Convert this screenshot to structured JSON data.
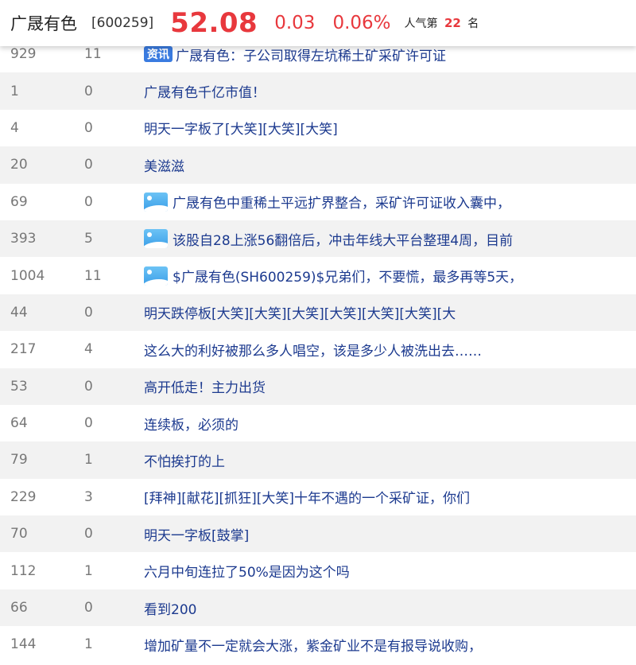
{
  "header": {
    "stock_name": "广晟有色",
    "stock_code": "[600259]",
    "price": "52.08",
    "change": "0.03",
    "change_pct": "0.06%",
    "popularity_prefix": "人气第",
    "popularity_rank": "22",
    "popularity_suffix": "名"
  },
  "colors": {
    "up": "#e8383d",
    "title_link": "#1c3a8f",
    "meta": "#777777"
  },
  "posts": [
    {
      "reads": "929",
      "replies": "11",
      "title": "广晟有色：子公司取得左坑稀土矿采矿许可证",
      "tag": "资讯",
      "has_image": false
    },
    {
      "reads": "1",
      "replies": "0",
      "title": "广晟有色千亿市值！",
      "tag": "",
      "has_image": false
    },
    {
      "reads": "4",
      "replies": "0",
      "title": "明天一字板了[大笑][大笑][大笑]",
      "tag": "",
      "has_image": false
    },
    {
      "reads": "20",
      "replies": "0",
      "title": "美滋滋",
      "tag": "",
      "has_image": false
    },
    {
      "reads": "69",
      "replies": "0",
      "title": "广晟有色中重稀土平远扩界整合，采矿许可证收入囊中，",
      "tag": "",
      "has_image": true
    },
    {
      "reads": "393",
      "replies": "5",
      "title": "该股自28上涨56翻倍后，冲击年线大平台整理4周，目前",
      "tag": "",
      "has_image": true
    },
    {
      "reads": "1004",
      "replies": "11",
      "title": "$广晟有色(SH600259)$兄弟们，不要慌，最多再等5天，",
      "tag": "",
      "has_image": true
    },
    {
      "reads": "44",
      "replies": "0",
      "title": "明天跌停板[大笑][大笑][大笑][大笑][大笑][大笑][大",
      "tag": "",
      "has_image": false
    },
    {
      "reads": "217",
      "replies": "4",
      "title": "这么大的利好被那么多人唱空，该是多少人被洗出去……",
      "tag": "",
      "has_image": false
    },
    {
      "reads": "53",
      "replies": "0",
      "title": "高开低走！主力出货",
      "tag": "",
      "has_image": false
    },
    {
      "reads": "64",
      "replies": "0",
      "title": "连续板，必须的",
      "tag": "",
      "has_image": false
    },
    {
      "reads": "79",
      "replies": "1",
      "title": "不怕挨打的上",
      "tag": "",
      "has_image": false
    },
    {
      "reads": "229",
      "replies": "3",
      "title": "[拜神][献花][抓狂][大笑]十年不遇的一个采矿证，你们",
      "tag": "",
      "has_image": false
    },
    {
      "reads": "70",
      "replies": "0",
      "title": "明天一字板[鼓掌]",
      "tag": "",
      "has_image": false
    },
    {
      "reads": "112",
      "replies": "1",
      "title": "六月中旬连拉了50%是因为这个吗",
      "tag": "",
      "has_image": false
    },
    {
      "reads": "66",
      "replies": "0",
      "title": "看到200",
      "tag": "",
      "has_image": false
    },
    {
      "reads": "144",
      "replies": "1",
      "title": "增加矿量不一定就会大涨，紫金矿业不是有报导说收购，",
      "tag": "",
      "has_image": false
    }
  ]
}
